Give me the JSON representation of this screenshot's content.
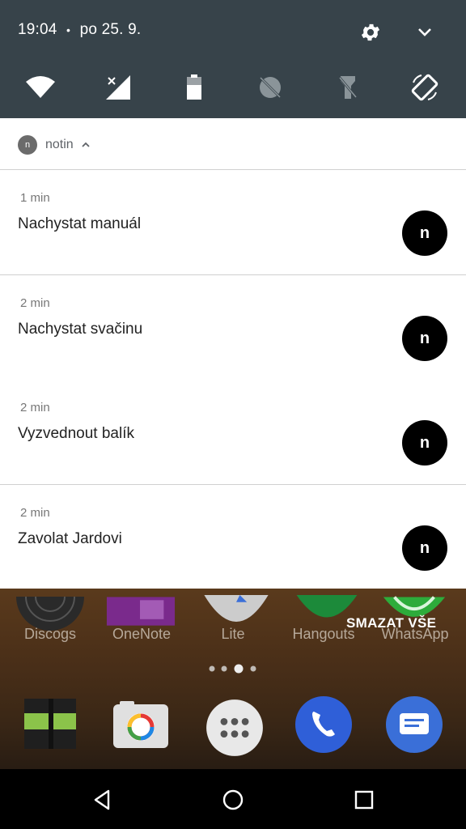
{
  "status": {
    "time": "19:04",
    "separator": "•",
    "date": "po 25. 9."
  },
  "quick_settings": {
    "tiles": [
      "wifi-icon",
      "cell-signal-off-icon",
      "battery-icon",
      "data-saver-icon",
      "flashlight-off-icon",
      "auto-rotate-icon"
    ]
  },
  "notification_group": {
    "app_badge": "n",
    "app_name": "notin"
  },
  "notifications": [
    {
      "time": "1 min",
      "title": "Nachystat manuál",
      "avatar": "n"
    },
    {
      "time": "2 min",
      "title": "Nachystat svačinu",
      "avatar": "n"
    },
    {
      "time": "2 min",
      "title": "Vyzvednout balík",
      "avatar": "n"
    },
    {
      "time": "2 min",
      "title": "Zavolat Jardovi",
      "avatar": "n"
    }
  ],
  "home": {
    "clear_all": "SMAZAT VŠE",
    "apps": [
      {
        "label": "Discogs"
      },
      {
        "label": "OneNote"
      },
      {
        "label": "Lite"
      },
      {
        "label": "Hangouts"
      },
      {
        "label": "WhatsApp"
      }
    ]
  },
  "colors": {
    "header_bg": "#37434a",
    "notification_bg": "#ffffff",
    "avatar_bg": "#000000"
  }
}
